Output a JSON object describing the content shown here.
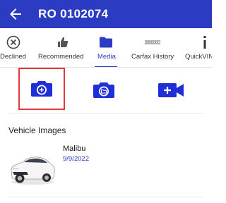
{
  "app_bar": {
    "title": "RO 0102074",
    "back_icon": "arrow-left-icon",
    "background": "#2b3cc2"
  },
  "tabs": [
    {
      "label": "Declined",
      "icon": "x-circle-icon",
      "active": false
    },
    {
      "label": "Recommended",
      "icon": "thumbs-up-icon",
      "active": false
    },
    {
      "label": "Media",
      "icon": "folder-icon",
      "active": true
    },
    {
      "label": "Carfax History",
      "icon": "carfax-logo-icon",
      "active": false
    },
    {
      "label": "QuickVIN",
      "icon": "info-icon",
      "active": false
    }
  ],
  "media_actions": [
    {
      "icon": "camera-add-icon",
      "highlighted": true
    },
    {
      "icon": "camera-folder-icon",
      "highlighted": false
    },
    {
      "icon": "video-add-icon",
      "highlighted": false
    }
  ],
  "vehicle_images": {
    "section_title": "Vehicle Images",
    "items": [
      {
        "name": "Malibu",
        "date": "9/9/2022",
        "thumbnail": "white-sedan-image"
      }
    ]
  },
  "colors": {
    "accent": "#2b3cc2",
    "highlight_border": "#e53935"
  }
}
